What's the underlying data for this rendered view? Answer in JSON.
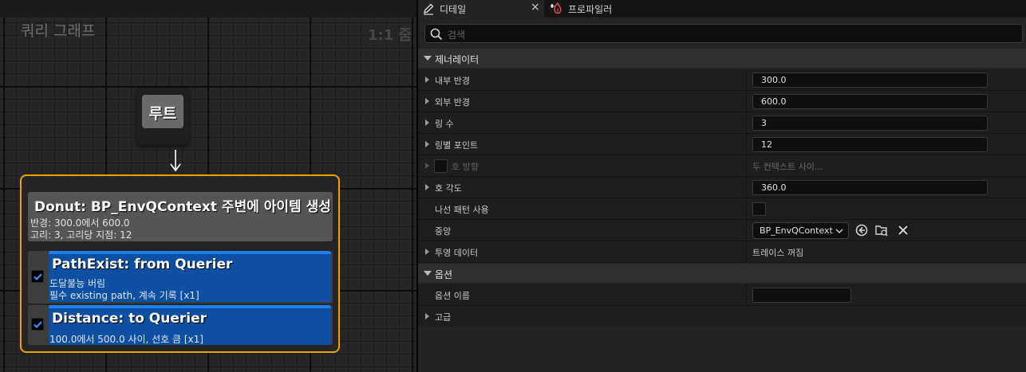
{
  "graph": {
    "title": "쿼리 그래프",
    "zoom": "1:1 줌",
    "root_label": "루트",
    "generator": {
      "title": "Donut: BP_EnvQContext 주변에 아이템 생성",
      "line1": "반경: 300.0에서 600.0",
      "line2": "고리: 3, 고리당 지점: 12"
    },
    "tests": [
      {
        "title": "PathExist: from Querier",
        "line1": "도달불능 버림",
        "line2": "필수 existing path, 계속 기록 [x1]",
        "checked": true
      },
      {
        "title": "Distance: to Querier",
        "line1": "100.0에서 500.0 사이, 선호 큼 [x1]",
        "checked": true
      }
    ]
  },
  "tabs": {
    "details": "디테일",
    "close": "×",
    "profiler": "프로파일러"
  },
  "search": {
    "placeholder": "검색"
  },
  "categories": {
    "generator": "제너레이터",
    "option": "옵션"
  },
  "properties": {
    "inner_radius": {
      "label": "내부 반경",
      "value": "300.0"
    },
    "outer_radius": {
      "label": "외부 반경",
      "value": "600.0"
    },
    "ring_count": {
      "label": "링 수",
      "value": "3"
    },
    "points_per_ring": {
      "label": "링별 포인트",
      "value": "12"
    },
    "arc_direction": {
      "label": "호 방향",
      "value": "두 컨텍스트 사이..."
    },
    "arc_angle": {
      "label": "호 각도",
      "value": "360.0"
    },
    "spiral_pattern": {
      "label": "나선 패턴 사용"
    },
    "center": {
      "label": "중앙",
      "value": "BP_EnvQContext"
    },
    "projection_data": {
      "label": "투영 데이터",
      "value": "트레이스 꺼짐"
    },
    "option_name": {
      "label": "옵션 이름",
      "value": ""
    },
    "advanced": {
      "label": "고급"
    }
  },
  "colors": {
    "accent": "#f2a000",
    "test_card": "#0d4fa2",
    "check": "#3d8fff"
  }
}
